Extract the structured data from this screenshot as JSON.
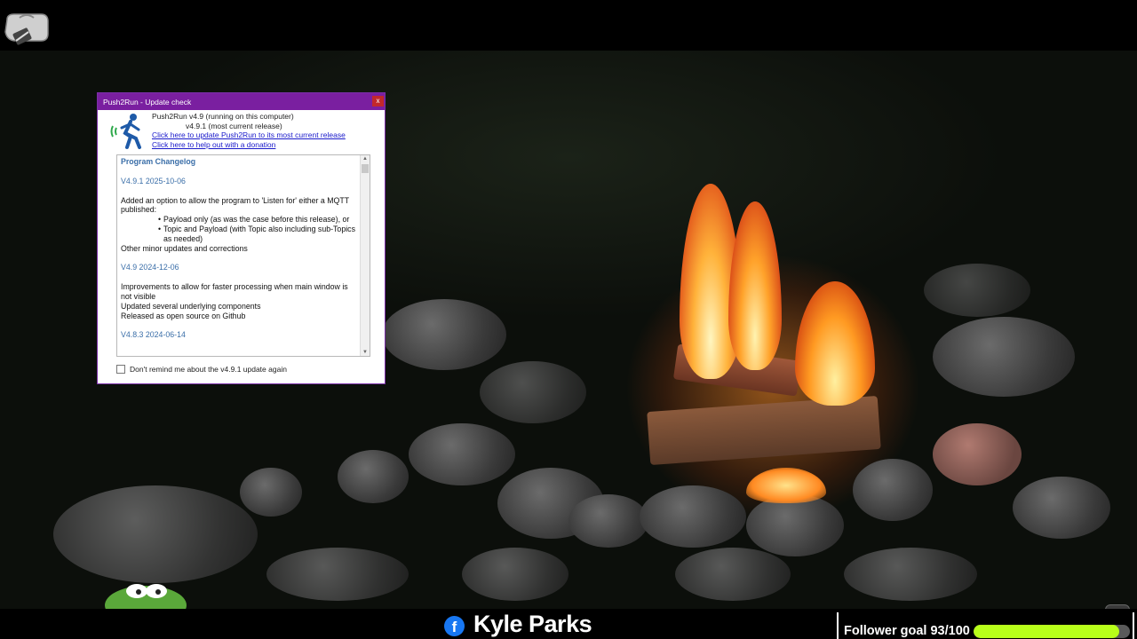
{
  "dialog": {
    "title": "Push2Run - Update check",
    "close_label": "x",
    "current_version": "Push2Run v4.9 (running on this computer)",
    "latest_version": "v4.9.1 (most current release)",
    "update_link": "Click here to update Push2Run to its most current release",
    "donate_link": "Click here to help out with a donation",
    "changelog": {
      "heading": "Program Changelog",
      "releases": [
        {
          "version": "V4.9.1 2025-10-06",
          "intro": "Added an option to allow the program to 'Listen for' either a MQTT published:",
          "bullets": [
            "Payload only (as was the case before this release), or",
            "Topic and Payload (with Topic also including sub-Topics as needed)"
          ],
          "after": "Other minor updates and corrections"
        },
        {
          "version": "V4.9 2024-12-06",
          "lines": [
            "Improvements to allow for faster processing when main window is not visible",
            "Updated several underlying components",
            "Released as open source on Github"
          ]
        },
        {
          "version": "V4.8.3 2024-06-14"
        }
      ]
    },
    "remind_label": "Don't remind me about the v4.9.1 update again",
    "remind_checked": false
  },
  "stream": {
    "facebook_icon": "f",
    "name": "Kyle Parks",
    "follower_goal_label": "Follower goal 93/100",
    "follower_current": 93,
    "follower_target": 100,
    "accent_color": "#b8ff1a"
  },
  "colors": {
    "titlebar": "#7a1fa0",
    "close": "#c2282b",
    "link": "#1a1acb",
    "changelog_heading": "#3a6ea8"
  }
}
